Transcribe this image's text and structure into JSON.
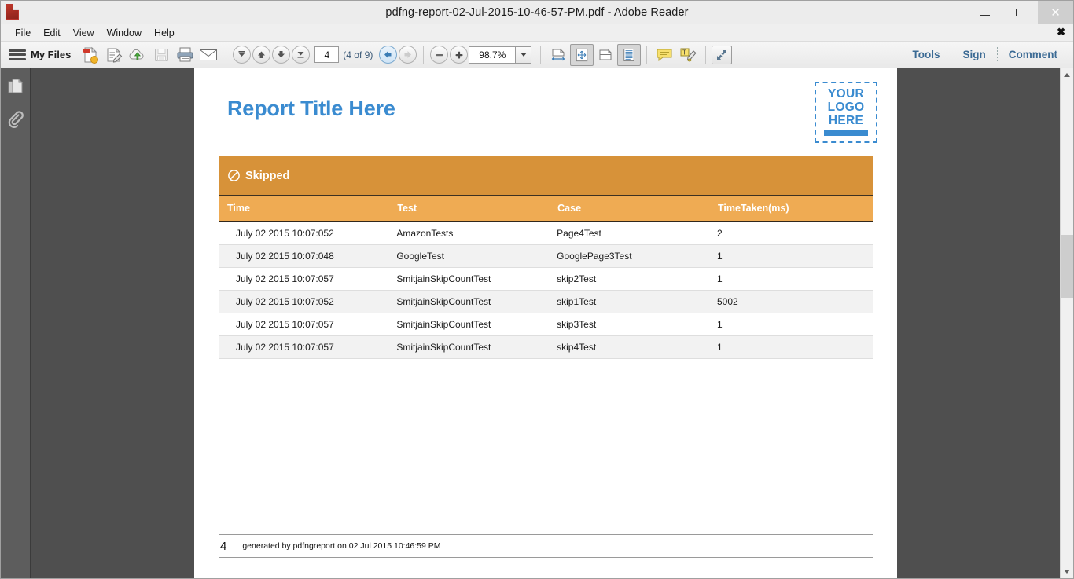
{
  "window": {
    "title": "pdfng-report-02-Jul-2015-10-46-57-PM.pdf - Adobe Reader",
    "app_icon": "pdf-file-icon",
    "controls": {
      "minimize": "minimize-icon",
      "maximize": "maximize-icon",
      "close": "✕"
    }
  },
  "menubar": {
    "items": [
      "File",
      "Edit",
      "View",
      "Window",
      "Help"
    ],
    "close_label": "✖"
  },
  "toolbar": {
    "menu_icon": "hamburger-icon",
    "my_files_label": "My Files",
    "icons": [
      "create-pdf-icon",
      "edit-pdf-icon",
      "upload-cloud-icon",
      "save-icon",
      "print-icon",
      "email-icon"
    ],
    "nav": {
      "first_page": "first-page-icon",
      "prev_page": "previous-page-icon",
      "next_page": "next-page-icon",
      "last_page": "last-page-icon"
    },
    "page_number": "4",
    "page_of": "(4 of 9)",
    "previous_view": "previous-view-icon",
    "next_view": "next-view-icon",
    "zoom_out": "zoom-out-icon",
    "zoom_in": "zoom-in-icon",
    "zoom_level": "98.7%",
    "zoom_dropdown": "chevron-down-icon",
    "view_icons": [
      "fit-width-icon",
      "fit-page-icon",
      "fit-visible-icon",
      "page-display-icon"
    ],
    "comment_icon": "sticky-note-icon",
    "highlight_icon": "highlight-text-icon",
    "fullscreen_icon": "read-mode-icon",
    "right_links": [
      "Tools",
      "Sign",
      "Comment"
    ]
  },
  "navpane": {
    "items": [
      "page-thumbnails-icon",
      "attachments-icon"
    ]
  },
  "scrollbar": {
    "up_arrow": "scroll-up-icon",
    "down_arrow": "scroll-down-icon"
  },
  "document": {
    "report_title": "Report Title Here",
    "logo": {
      "line1": "YOUR",
      "line2": "LOGO",
      "line3": "HERE"
    },
    "panel": {
      "status_icon": "no-entry-skipped-icon",
      "status_label": "Skipped",
      "accent_dark": "#d79239",
      "accent_light": "#efab53",
      "columns": [
        "Time",
        "Test",
        "Case",
        "TimeTaken(ms)"
      ],
      "rows": [
        [
          "July 02 2015 10:07:052",
          "AmazonTests",
          "Page4Test",
          "2"
        ],
        [
          "July 02 2015 10:07:048",
          "GoogleTest",
          "GooglePage3Test",
          "1"
        ],
        [
          "July 02 2015 10:07:057",
          "SmitjainSkipCountTest",
          "skip2Test",
          "1"
        ],
        [
          "July 02 2015 10:07:052",
          "SmitjainSkipCountTest",
          "skip1Test",
          "5002"
        ],
        [
          "July 02 2015 10:07:057",
          "SmitjainSkipCountTest",
          "skip3Test",
          "1"
        ],
        [
          "July 02 2015 10:07:057",
          "SmitjainSkipCountTest",
          "skip4Test",
          "1"
        ]
      ]
    },
    "footer": {
      "page_number": "4",
      "generated_text": "generated by pdfngreport  on 02 Jul 2015 10:46:59 PM"
    }
  }
}
